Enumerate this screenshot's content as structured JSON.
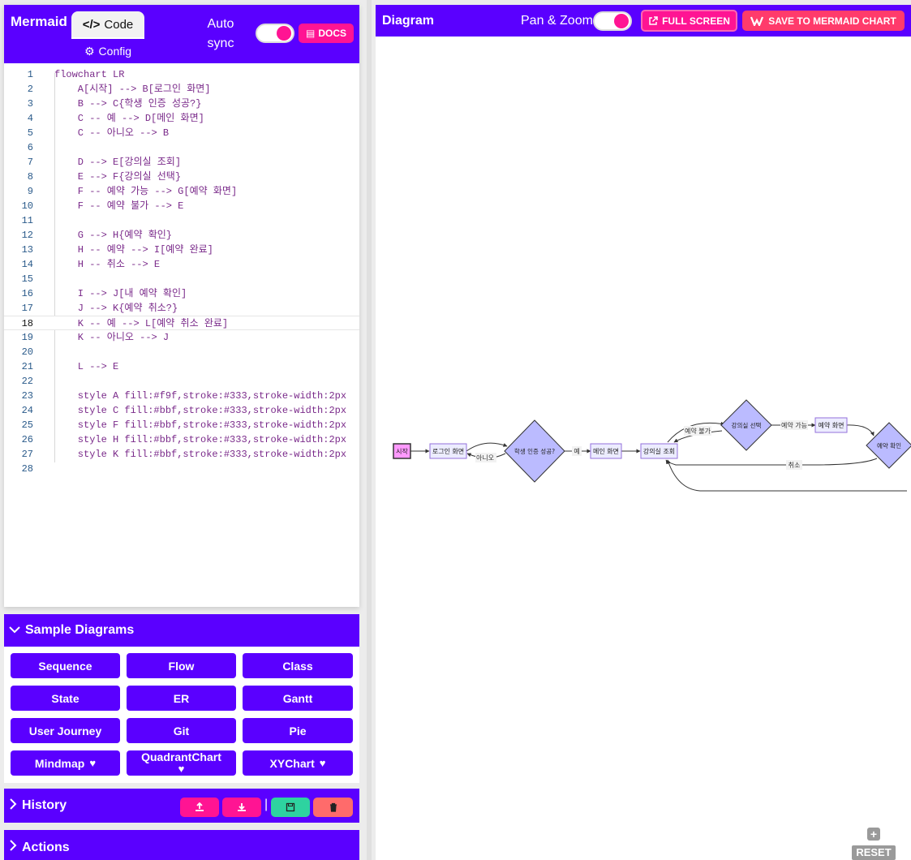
{
  "editor": {
    "brand": "Mermaid",
    "tab_code": "Code",
    "tab_config": "Config",
    "autosync_label": "Auto sync",
    "autosync_on": true,
    "docs_label": "DOCS",
    "active_line": 18,
    "lines": [
      {
        "n": "1",
        "t": "flowchart LR"
      },
      {
        "n": "2",
        "t": "    A[시작] --> B[로그인 화면]"
      },
      {
        "n": "3",
        "t": "    B --> C{학생 인증 성공?}"
      },
      {
        "n": "4",
        "t": "    C -- 예 --> D[메인 화면]"
      },
      {
        "n": "5",
        "t": "    C -- 아니오 --> B"
      },
      {
        "n": "6",
        "t": ""
      },
      {
        "n": "7",
        "t": "    D --> E[강의실 조회]"
      },
      {
        "n": "8",
        "t": "    E --> F{강의실 선택}"
      },
      {
        "n": "9",
        "t": "    F -- 예약 가능 --> G[예약 화면]"
      },
      {
        "n": "10",
        "t": "    F -- 예약 불가 --> E"
      },
      {
        "n": "11",
        "t": ""
      },
      {
        "n": "12",
        "t": "    G --> H{예약 확인}"
      },
      {
        "n": "13",
        "t": "    H -- 예약 --> I[예약 완료]"
      },
      {
        "n": "14",
        "t": "    H -- 취소 --> E"
      },
      {
        "n": "15",
        "t": ""
      },
      {
        "n": "16",
        "t": "    I --> J[내 예약 확인]"
      },
      {
        "n": "17",
        "t": "    J --> K{예약 취소?}"
      },
      {
        "n": "18",
        "t": "    K -- 예 --> L[예약 취소 완료]"
      },
      {
        "n": "19",
        "t": "    K -- 아니오 --> J"
      },
      {
        "n": "20",
        "t": ""
      },
      {
        "n": "21",
        "t": "    L --> E"
      },
      {
        "n": "22",
        "t": ""
      },
      {
        "n": "23",
        "t": "    style A fill:#f9f,stroke:#333,stroke-width:2px"
      },
      {
        "n": "24",
        "t": "    style C fill:#bbf,stroke:#333,stroke-width:2px"
      },
      {
        "n": "25",
        "t": "    style F fill:#bbf,stroke:#333,stroke-width:2px"
      },
      {
        "n": "26",
        "t": "    style H fill:#bbf,stroke:#333,stroke-width:2px"
      },
      {
        "n": "27",
        "t": "    style K fill:#bbf,stroke:#333,stroke-width:2px"
      },
      {
        "n": "28",
        "t": ""
      }
    ]
  },
  "samples": {
    "title": "Sample Diagrams",
    "buttons": [
      {
        "label": "Sequence",
        "heart": false
      },
      {
        "label": "Flow",
        "heart": false
      },
      {
        "label": "Class",
        "heart": false
      },
      {
        "label": "State",
        "heart": false
      },
      {
        "label": "ER",
        "heart": false
      },
      {
        "label": "Gantt",
        "heart": false
      },
      {
        "label": "User Journey",
        "heart": false
      },
      {
        "label": "Git",
        "heart": false
      },
      {
        "label": "Pie",
        "heart": false
      },
      {
        "label": "Mindmap",
        "heart": true
      },
      {
        "label": "QuadrantChart",
        "heart": true
      },
      {
        "label": "XYChart",
        "heart": true
      }
    ]
  },
  "history": {
    "title": "History",
    "separator": "|"
  },
  "actions": {
    "title": "Actions"
  },
  "diagram": {
    "title": "Diagram",
    "panzoom_label": "Pan & Zoom",
    "panzoom_on": true,
    "fullscreen_label": "FULL SCREEN",
    "save_label": "SAVE TO MERMAID CHART",
    "reset_label": "RESET",
    "nodes": {
      "start": "시작",
      "login": "로그인 화면",
      "auth": "학생 인증 성공?",
      "main": "메인 화면",
      "room_search": "강의실 조회",
      "room_select": "강의실 선택",
      "booking": "예약 화면",
      "confirm": "예약 확인"
    },
    "edges": {
      "no": "아니오",
      "yes": "예",
      "unavailable": "예약 불가",
      "available": "예약 가능",
      "cancel": "취소"
    }
  },
  "colors": {
    "primary": "#5a00ff",
    "accent": "#ff1493",
    "node_start_fill": "#ff99ff",
    "node_diamond_fill": "#bbbbff",
    "node_rect_fill": "#ececff"
  }
}
